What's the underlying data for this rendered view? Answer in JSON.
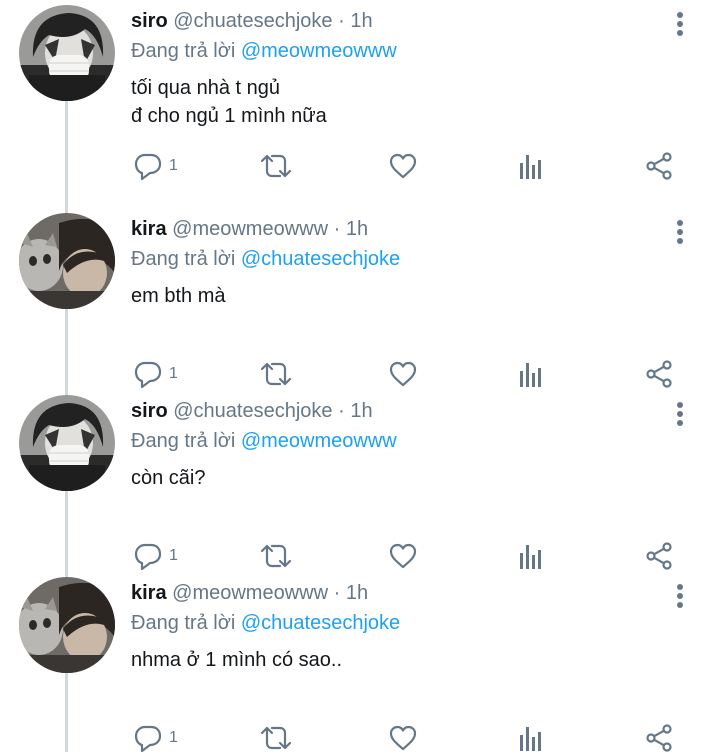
{
  "tweets": [
    {
      "name": "siro",
      "handle": "@chuatesechjoke",
      "separator": "·",
      "time": "1h",
      "reply_prefix": "Đang trả lời",
      "reply_to": "@meowmeowww",
      "text_lines": [
        "tối qua nhà t ngủ",
        "đ cho ngủ 1 mình nữa"
      ],
      "reply_count": "1",
      "avatar": "siro-avatar"
    },
    {
      "name": "kira",
      "handle": "@meowmeowww",
      "separator": "·",
      "time": "1h",
      "reply_prefix": "Đang trả lời",
      "reply_to": "@chuatesechjoke",
      "text_lines": [
        "em bth mà"
      ],
      "reply_count": "1",
      "avatar": "kira-avatar"
    },
    {
      "name": "siro",
      "handle": "@chuatesechjoke",
      "separator": "·",
      "time": "1h",
      "reply_prefix": "Đang trả lời",
      "reply_to": "@meowmeowww",
      "text_lines": [
        "còn cãi?"
      ],
      "reply_count": "1",
      "avatar": "siro-avatar"
    },
    {
      "name": "kira",
      "handle": "@meowmeowww",
      "separator": "·",
      "time": "1h",
      "reply_prefix": "Đang trả lời",
      "reply_to": "@chuatesechjoke",
      "text_lines": [
        "nhma ở 1 mình có sao.."
      ],
      "reply_count": "1",
      "avatar": "kira-avatar"
    }
  ],
  "icons": {
    "reply": "reply-icon",
    "retweet": "retweet-icon",
    "like": "heart-icon",
    "analytics": "analytics-icon",
    "share": "share-icon",
    "more": "more-vertical-icon"
  },
  "colors": {
    "name": "#14171a",
    "meta": "#657786",
    "mention": "#1da1f2",
    "thread_line": "#cfd9de",
    "background": "#ffffff"
  }
}
